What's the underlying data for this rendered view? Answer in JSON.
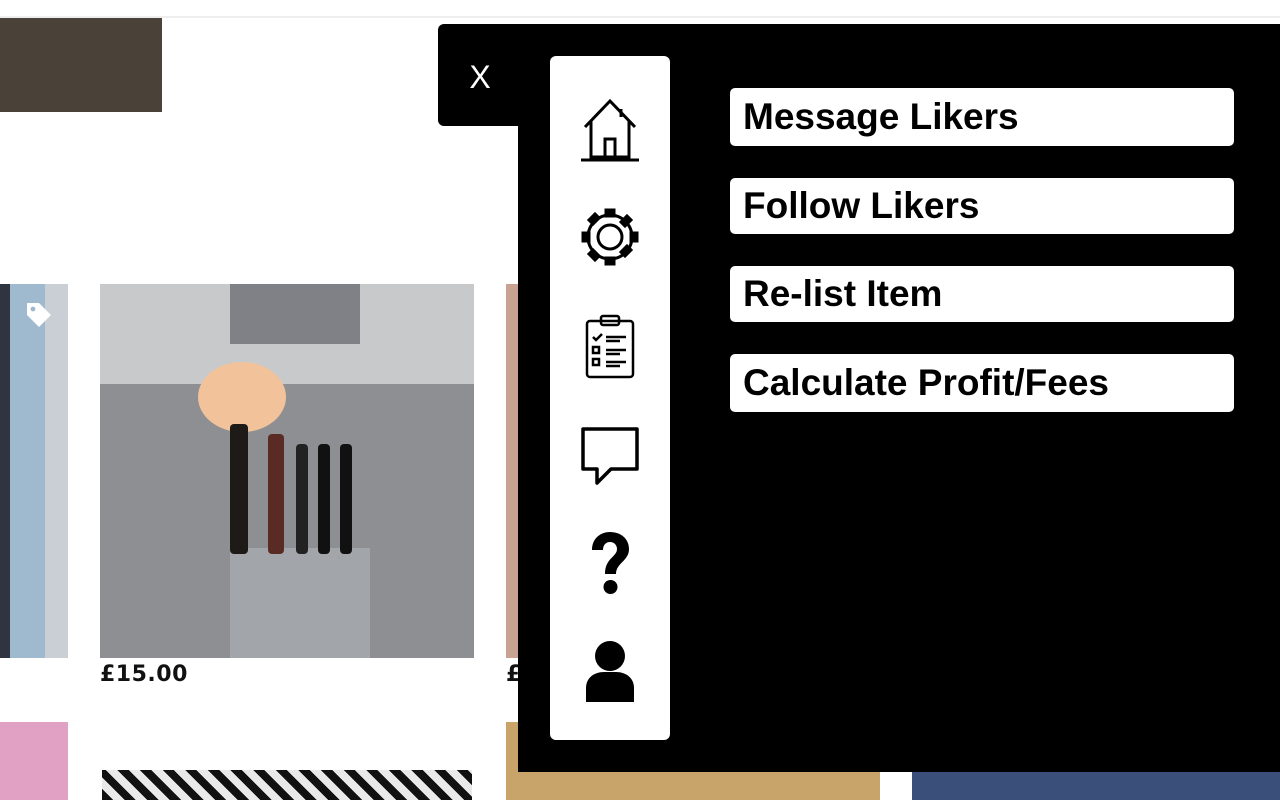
{
  "listings": [
    {
      "price": "£15.00"
    },
    {
      "price": "£"
    }
  ],
  "overlay": {
    "close_label": "X",
    "sidebar_icons": [
      "home-icon",
      "gear-icon",
      "checklist-icon",
      "chat-bubble-icon",
      "help-icon",
      "user-icon"
    ],
    "actions": [
      {
        "label": "Message Likers"
      },
      {
        "label": "Follow Likers"
      },
      {
        "label": "Re-list Item"
      },
      {
        "label": "Calculate Profit/Fees"
      }
    ]
  },
  "colors": {
    "overlay_bg": "#000000",
    "card_bg": "#ffffff"
  }
}
